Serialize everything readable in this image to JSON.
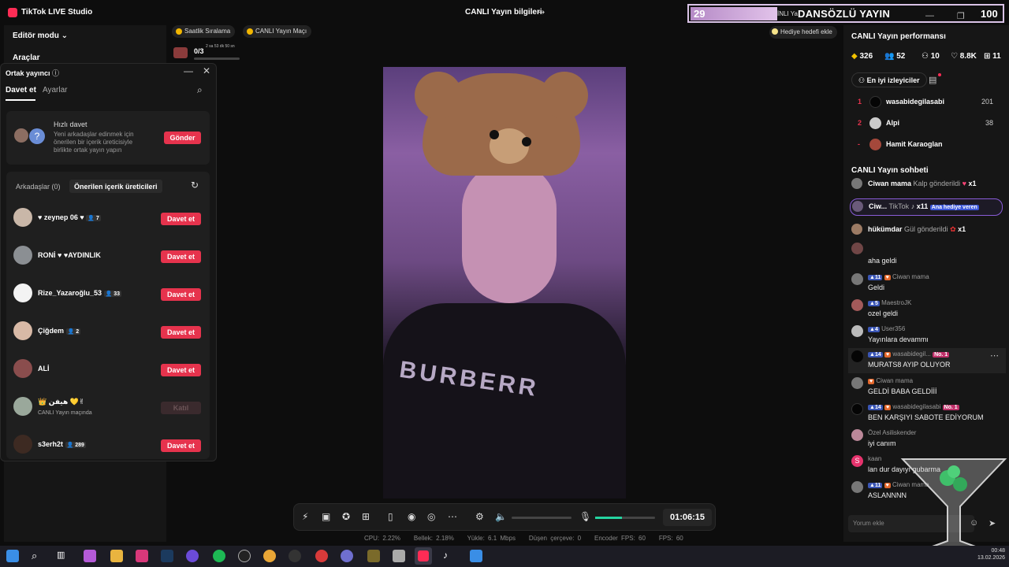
{
  "app": {
    "title": "TikTok LIVE Studio",
    "window_center": "CANLI Yayın bilgileri"
  },
  "overlay": {
    "num_left": "29",
    "small": "İNLI Ya",
    "title": "DANSÖZLÜ YAYIN",
    "num_right": "100"
  },
  "left": {
    "editor_mode": "Editör modu",
    "tools": "Araçlar"
  },
  "top_pills": {
    "hourly": "Saatlik Sıralama",
    "match": "CANLI Yayın Maçı",
    "progress": "0/3",
    "time": "2 sa 53 dk 50 sn",
    "gift_goal": "Hediye hedefi ekle"
  },
  "cohost": {
    "title": "Ortak yayıncı",
    "tabs": [
      "Davet et",
      "Ayarlar"
    ],
    "quick_title": "Hızlı davet",
    "quick_desc": "Yeni arkadaşlar edinmek için önerilen bir içerik üreticisiyle birlikte ortak yayın yapın",
    "quick_btn": "Gönder",
    "friends_tab": "Arkadaşlar (0)",
    "suggested_tab": "Önerilen içerik üreticileri",
    "rows": [
      {
        "name": "♥ zeynep 06 ♥",
        "count": "7",
        "btn": "Davet et"
      },
      {
        "name": "RONİ ♥ ♥AYDINLIK",
        "count": "",
        "btn": "Davet et"
      },
      {
        "name": "Rize_Yazaroğlu_53",
        "count": "33",
        "btn": "Davet et"
      },
      {
        "name": "Çiğdem",
        "count": "2",
        "btn": "Davet et"
      },
      {
        "name": "ALİ",
        "count": "",
        "btn": "Davet et"
      },
      {
        "name": "👑 هیفن 💛✌",
        "count": "",
        "sub": "CANLI Yayın maçında",
        "btn": "Katıl"
      },
      {
        "name": "s3erh2t",
        "count": "289",
        "btn": "Davet et"
      }
    ]
  },
  "controls": {
    "timer": "01:06:15"
  },
  "stats": {
    "cpu": "CPU: 2.22%",
    "mem": "Bellek: 2.18%",
    "upload": "Yükle: 6.1 Mbps",
    "drop": "Düşen çerçeve: 0",
    "enc": "Encoder FPS: 60",
    "fps": "FPS: 60"
  },
  "perf": {
    "title": "CANLI Yayın performansı",
    "values": [
      "326",
      "52",
      "10",
      "8.8K",
      "11"
    ],
    "best_viewers": "En iyi izleyiciler",
    "ranking": [
      {
        "rank": "1",
        "name": "wasabidegilasabi",
        "score": "201"
      },
      {
        "rank": "2",
        "name": "Alpi",
        "score": "38"
      },
      {
        "rank": "-",
        "name": "Hamit Karaoglan",
        "score": ""
      }
    ]
  },
  "chat": {
    "title": "CANLI Yayın sohbeti",
    "gifts": [
      {
        "user": "Ciwan mama",
        "text": "Kalp gönderildi",
        "count": "x1"
      },
      {
        "user": "Ciw...",
        "text": "TikTok",
        "count": "x11",
        "badge": "Ana hediye veren"
      },
      {
        "user": "hükümdar",
        "text": "Gül gönderildi",
        "count": "x1"
      }
    ],
    "messages": [
      {
        "user": "",
        "level": "",
        "text": "aha geldi"
      },
      {
        "user": "Ciwan mama",
        "level": "11",
        "text": "Geldi"
      },
      {
        "user": "MaestroJK",
        "level": "5",
        "text": "ozel geldi"
      },
      {
        "user": "User356",
        "level": "4",
        "text": "Yayınlara devammı"
      },
      {
        "user": "wasabidegil...",
        "level": "14",
        "text": "MURATS8 AYIP OLUYOR",
        "badge": "No. 1"
      },
      {
        "user": "Ciwan mama",
        "level": "",
        "text": "GELDİ BABA GELDİİİ"
      },
      {
        "user": "wasabidegilasabi",
        "level": "14",
        "text": "BEN KARŞIYI SABOTE EDİYORUM",
        "badge": "No. 1"
      },
      {
        "user": "Özel Asiliskender",
        "level": "",
        "text": "iyi canım"
      },
      {
        "user": "kaan",
        "level": "",
        "text": "lan dur dayıyı gubarma"
      },
      {
        "user": "Ciwan mama",
        "level": "11",
        "text": "ASLANNNN"
      }
    ],
    "input_placeholder": "Yorum ekle"
  },
  "clock": {
    "time": "00:48",
    "date": "13.02.2026"
  }
}
